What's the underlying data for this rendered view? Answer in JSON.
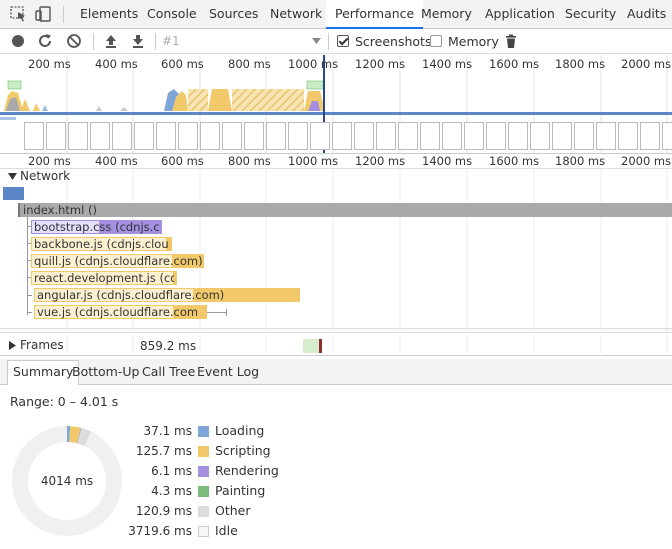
{
  "tabs": [
    {
      "label": "Elements"
    },
    {
      "label": "Console"
    },
    {
      "label": "Sources"
    },
    {
      "label": "Network"
    },
    {
      "label": "Performance",
      "active": true
    },
    {
      "label": "Memory"
    },
    {
      "label": "Application"
    },
    {
      "label": "Security"
    },
    {
      "label": "Audits"
    }
  ],
  "toolbar": {
    "recording_select": "#1",
    "screenshots_label": "Screenshots",
    "screenshots_checked": true,
    "memory_label": "Memory",
    "memory_checked": false
  },
  "ruler_ticks": [
    "200 ms",
    "400 ms",
    "600 ms",
    "800 ms",
    "1000 ms",
    "1200 ms",
    "1400 ms",
    "1600 ms",
    "1800 ms",
    "2000 ms"
  ],
  "network": {
    "section_label": "Network",
    "root": "index.html ()",
    "requests": [
      {
        "name": "bootstrap.css",
        "host": "(cdnjs.clo…",
        "type": "stylesheet"
      },
      {
        "name": "backbone.js",
        "host": "(cdnjs.cloudfl…",
        "type": "script"
      },
      {
        "name": "quill.js",
        "host": "(cdnjs.cloudflare.com)",
        "type": "script"
      },
      {
        "name": "react.development.js",
        "host": "(cdnjs…",
        "type": "script"
      },
      {
        "name": "angular.js",
        "host": "(cdnjs.cloudflare.com)",
        "type": "script"
      },
      {
        "name": "vue.js",
        "host": "(cdnjs.cloudflare.com)",
        "type": "script"
      }
    ]
  },
  "frames": {
    "label": "Frames",
    "value": "859.2 ms"
  },
  "summary_tabs": [
    "Summary",
    "Bottom-Up",
    "Call Tree",
    "Event Log"
  ],
  "summary": {
    "range": "Range: 0 – 4.01 s",
    "total": "4014 ms",
    "legend": [
      {
        "value": "37.1 ms",
        "label": "Loading",
        "color": "#7fa6d8"
      },
      {
        "value": "125.7 ms",
        "label": "Scripting",
        "color": "#f2c96a"
      },
      {
        "value": "6.1 ms",
        "label": "Rendering",
        "color": "#a48fe0"
      },
      {
        "value": "4.3 ms",
        "label": "Painting",
        "color": "#7cbc7a"
      },
      {
        "value": "120.9 ms",
        "label": "Other",
        "color": "#dcdcdc"
      },
      {
        "value": "3719.6 ms",
        "label": "Idle",
        "color": "#f7f7f7"
      }
    ]
  },
  "colors": {
    "accent": "#1a73e8",
    "scripting": "#f2c96a",
    "rendering": "#a48fe0",
    "loading": "#7fa6d8",
    "painting": "#7cbc7a"
  }
}
